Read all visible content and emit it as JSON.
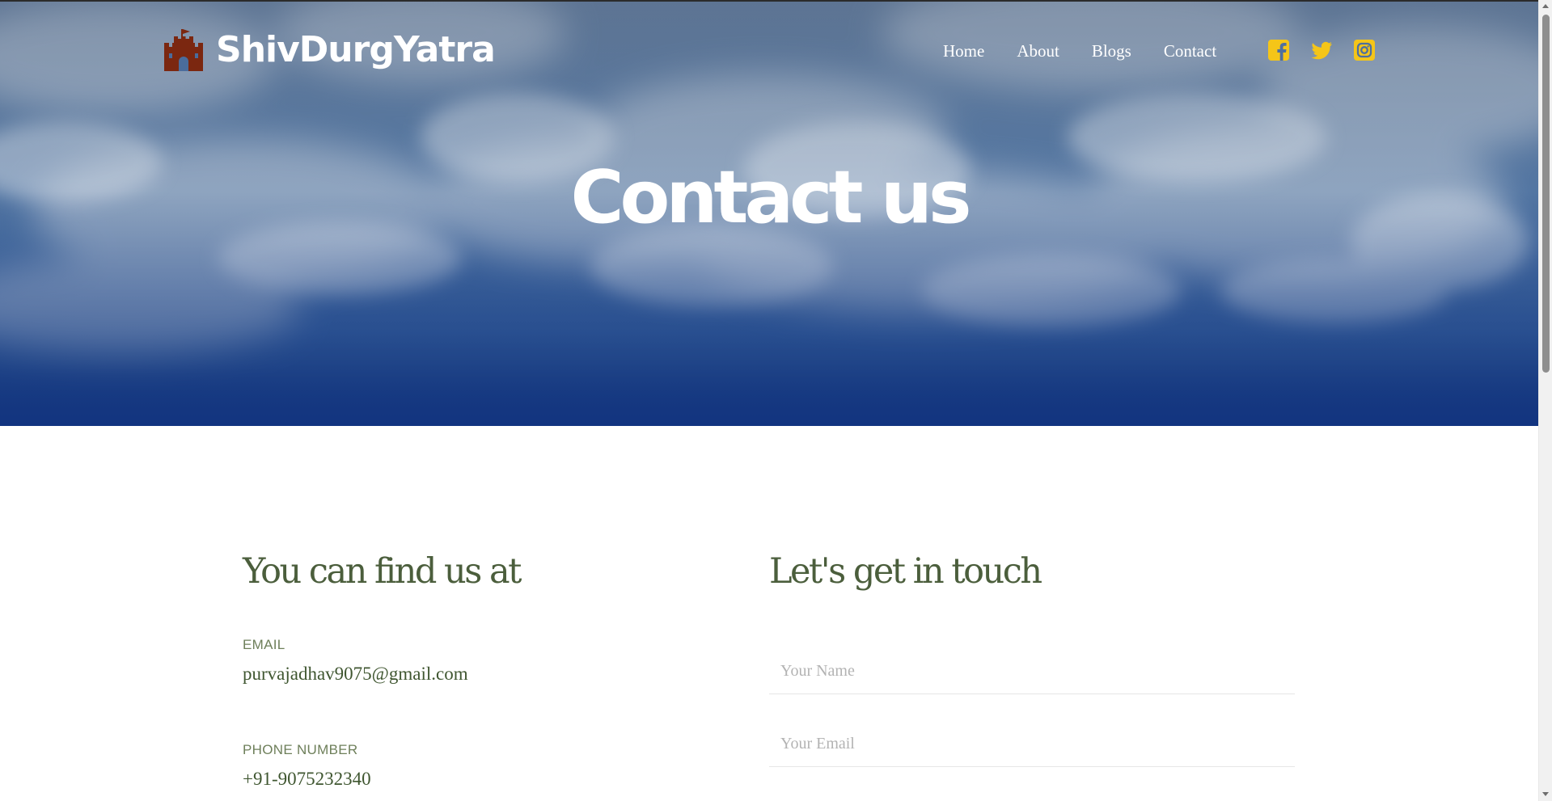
{
  "navbar": {
    "brand_name": "ShivDurgYatra",
    "brand_icon": "castle-icon",
    "links": [
      {
        "label": "Home"
      },
      {
        "label": "About"
      },
      {
        "label": "Blogs"
      },
      {
        "label": "Contact"
      }
    ],
    "socials": [
      {
        "icon": "facebook-icon"
      },
      {
        "icon": "twitter-icon"
      },
      {
        "icon": "instagram-icon"
      }
    ]
  },
  "hero": {
    "title": "Contact us"
  },
  "find_us": {
    "heading": "You can find us at",
    "email_label": "EMAIL",
    "email_value": "purvajadhav9075@gmail.com",
    "phone_label": "PHONE NUMBER",
    "phone_value": "+91-9075232340"
  },
  "contact_form": {
    "heading": "Let's get in touch",
    "name_placeholder": "Your Name",
    "email_placeholder": "Your Email"
  },
  "colors": {
    "brand_icon": "#7b2710",
    "social_icon": "#f5c518",
    "heading_text": "#4b5e3c",
    "hero_bottom": "#17397e"
  }
}
